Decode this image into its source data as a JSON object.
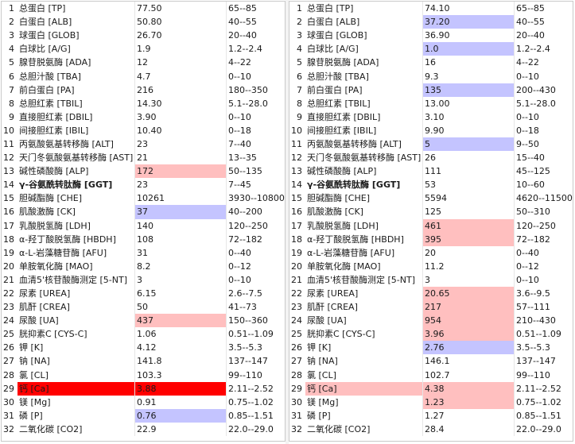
{
  "colors": {
    "high": "#ffbfbf",
    "critical": "#ff0000",
    "low": "#c4c4ff"
  },
  "panels": [
    {
      "rows": [
        {
          "no": "1",
          "name": "总蛋白 [TP]",
          "value": "77.50",
          "ref": "65--85",
          "flag": ""
        },
        {
          "no": "2",
          "name": "白蛋白 [ALB]",
          "value": "50.80",
          "ref": "40--55",
          "flag": ""
        },
        {
          "no": "3",
          "name": "球蛋白 [GLOB]",
          "value": "26.70",
          "ref": "20--40",
          "flag": ""
        },
        {
          "no": "4",
          "name": "白球比 [A/G]",
          "value": "1.9",
          "ref": "1.2--2.4",
          "flag": ""
        },
        {
          "no": "5",
          "name": "腺苷脱氨酶 [ADA]",
          "value": "12",
          "ref": "4--22",
          "flag": ""
        },
        {
          "no": "6",
          "name": "总胆汁酸 [TBA]",
          "value": "4.7",
          "ref": "0--10",
          "flag": ""
        },
        {
          "no": "7",
          "name": "前白蛋白 [PA]",
          "value": "216",
          "ref": "180--350",
          "flag": ""
        },
        {
          "no": "8",
          "name": "总胆红素 [TBIL]",
          "value": "14.30",
          "ref": "5.1--28.0",
          "flag": ""
        },
        {
          "no": "9",
          "name": "直接胆红素 [DBIL]",
          "value": "3.90",
          "ref": "0--10",
          "flag": ""
        },
        {
          "no": "10",
          "name": "间接胆红素 [IBIL]",
          "value": "10.40",
          "ref": "0--18",
          "flag": ""
        },
        {
          "no": "11",
          "name": "丙氨酸氨基转移酶 [ALT]",
          "value": "23",
          "ref": "7--40",
          "flag": ""
        },
        {
          "no": "12",
          "name": "天门冬氨酸氨基转移酶 [AST]",
          "value": "21",
          "ref": "13--35",
          "flag": ""
        },
        {
          "no": "13",
          "name": "碱性磷酸酶 [ALP]",
          "value": "172",
          "ref": "50--135",
          "flag": "high"
        },
        {
          "no": "14",
          "name": "γ-谷氨酰转肽酶 [GGT]",
          "value": "23",
          "ref": "7--45",
          "flag": "",
          "bold": true
        },
        {
          "no": "15",
          "name": "胆碱酯酶 [CHE]",
          "value": "10261",
          "ref": "3930--10800",
          "flag": ""
        },
        {
          "no": "16",
          "name": "肌酸激酶 [CK]",
          "value": "37",
          "ref": "40--200",
          "flag": "low"
        },
        {
          "no": "17",
          "name": "乳酸脱氢酶 [LDH]",
          "value": "140",
          "ref": "120--250",
          "flag": ""
        },
        {
          "no": "18",
          "name": "α-羟丁酸脱氢酶 [HBDH]",
          "value": "108",
          "ref": "72--182",
          "flag": ""
        },
        {
          "no": "19",
          "name": "α-L-岩藻糖苷酶 [AFU]",
          "value": "31",
          "ref": "0--40",
          "flag": ""
        },
        {
          "no": "20",
          "name": "单胺氧化酶 [MAO]",
          "value": "8.2",
          "ref": "0--12",
          "flag": ""
        },
        {
          "no": "21",
          "name": "血清5'核苷酸酶测定 [5-NT]",
          "value": "3",
          "ref": "0--10",
          "flag": ""
        },
        {
          "no": "22",
          "name": "尿素 [UREA]",
          "value": "6.15",
          "ref": "2.6--7.5",
          "flag": ""
        },
        {
          "no": "23",
          "name": "肌酐 [CREA]",
          "value": "50",
          "ref": "41--73",
          "flag": ""
        },
        {
          "no": "24",
          "name": "尿酸 [UA]",
          "value": "437",
          "ref": "150--360",
          "flag": "high"
        },
        {
          "no": "25",
          "name": "胱抑素C [CYS-C]",
          "value": "1.06",
          "ref": "0.51--1.09",
          "flag": ""
        },
        {
          "no": "26",
          "name": "钾 [K]",
          "value": "4.12",
          "ref": "3.5--5.3",
          "flag": ""
        },
        {
          "no": "27",
          "name": "钠 [NA]",
          "value": "141.8",
          "ref": "137--147",
          "flag": ""
        },
        {
          "no": "28",
          "name": "氯 [CL]",
          "value": "103.3",
          "ref": "99--110",
          "flag": ""
        },
        {
          "no": "29",
          "name": "钙 [Ca]",
          "value": "3.88",
          "ref": "2.11--2.52",
          "flag": "critical"
        },
        {
          "no": "30",
          "name": "镁 [Mg]",
          "value": "0.91",
          "ref": "0.75--1.02",
          "flag": ""
        },
        {
          "no": "31",
          "name": "磷 [P]",
          "value": "0.76",
          "ref": "0.85--1.51",
          "flag": "low"
        },
        {
          "no": "32",
          "name": "二氧化碳 [CO2]",
          "value": "22.9",
          "ref": "22.0--29.0",
          "flag": ""
        }
      ]
    },
    {
      "rows": [
        {
          "no": "1",
          "name": "总蛋白 [TP]",
          "value": "74.10",
          "ref": "65--85",
          "flag": ""
        },
        {
          "no": "2",
          "name": "白蛋白 [ALB]",
          "value": "37.20",
          "ref": "40--55",
          "flag": "low"
        },
        {
          "no": "3",
          "name": "球蛋白 [GLOB]",
          "value": "36.90",
          "ref": "20--40",
          "flag": ""
        },
        {
          "no": "4",
          "name": "白球比 [A/G]",
          "value": "1.0",
          "ref": "1.2--2.4",
          "flag": "low"
        },
        {
          "no": "5",
          "name": "腺苷脱氨酶 [ADA]",
          "value": "16",
          "ref": "4--22",
          "flag": ""
        },
        {
          "no": "6",
          "name": "总胆汁酸 [TBA]",
          "value": "9.3",
          "ref": "0--10",
          "flag": ""
        },
        {
          "no": "7",
          "name": "前白蛋白 [PA]",
          "value": "135",
          "ref": "200--430",
          "flag": "low"
        },
        {
          "no": "8",
          "name": "总胆红素 [TBIL]",
          "value": "13.00",
          "ref": "5.1--28.0",
          "flag": ""
        },
        {
          "no": "9",
          "name": "直接胆红素 [DBIL]",
          "value": "3.10",
          "ref": "0--10",
          "flag": ""
        },
        {
          "no": "10",
          "name": "间接胆红素 [IBIL]",
          "value": "9.90",
          "ref": "0--18",
          "flag": ""
        },
        {
          "no": "11",
          "name": "丙氨酸氨基转移酶 [ALT]",
          "value": "5",
          "ref": "9--50",
          "flag": "low"
        },
        {
          "no": "12",
          "name": "天门冬氨酸氨基转移酶 [AST]",
          "value": "26",
          "ref": "15--40",
          "flag": ""
        },
        {
          "no": "13",
          "name": "碱性磷酸酶 [ALP]",
          "value": "111",
          "ref": "45--125",
          "flag": ""
        },
        {
          "no": "14",
          "name": "γ-谷氨酰转肽酶 [GGT]",
          "value": "53",
          "ref": "10--60",
          "flag": "",
          "bold": true
        },
        {
          "no": "15",
          "name": "胆碱酯酶 [CHE]",
          "value": "5594",
          "ref": "4620--11500",
          "flag": ""
        },
        {
          "no": "16",
          "name": "肌酸激酶 [CK]",
          "value": "125",
          "ref": "50--310",
          "flag": ""
        },
        {
          "no": "17",
          "name": "乳酸脱氢酶 [LDH]",
          "value": "461",
          "ref": "120--250",
          "flag": "high"
        },
        {
          "no": "18",
          "name": "α-羟丁酸脱氢酶 [HBDH]",
          "value": "395",
          "ref": "72--182",
          "flag": "high"
        },
        {
          "no": "19",
          "name": "α-L-岩藻糖苷酶 [AFU]",
          "value": "20",
          "ref": "0--40",
          "flag": ""
        },
        {
          "no": "20",
          "name": "单胺氧化酶 [MAO]",
          "value": "11.2",
          "ref": "0--12",
          "flag": ""
        },
        {
          "no": "21",
          "name": "血清5'核苷酸酶测定 [5-NT]",
          "value": "3",
          "ref": "0--10",
          "flag": ""
        },
        {
          "no": "22",
          "name": "尿素 [UREA]",
          "value": "20.65",
          "ref": "3.6--9.5",
          "flag": "high"
        },
        {
          "no": "23",
          "name": "肌酐 [CREA]",
          "value": "217",
          "ref": "57--111",
          "flag": "high"
        },
        {
          "no": "24",
          "name": "尿酸 [UA]",
          "value": "954",
          "ref": "210--430",
          "flag": "high"
        },
        {
          "no": "25",
          "name": "胱抑素C [CYS-C]",
          "value": "3.96",
          "ref": "0.51--1.09",
          "flag": "high"
        },
        {
          "no": "26",
          "name": "钾 [K]",
          "value": "2.76",
          "ref": "3.5--5.3",
          "flag": "low"
        },
        {
          "no": "27",
          "name": "钠 [NA]",
          "value": "146.1",
          "ref": "137--147",
          "flag": ""
        },
        {
          "no": "28",
          "name": "氯 [CL]",
          "value": "102.7",
          "ref": "99--110",
          "flag": ""
        },
        {
          "no": "29",
          "name": "钙 [Ca]",
          "value": "4.38",
          "ref": "2.11--2.52",
          "flag": "high",
          "name_flag": "high"
        },
        {
          "no": "30",
          "name": "镁 [Mg]",
          "value": "1.23",
          "ref": "0.75--1.02",
          "flag": "high"
        },
        {
          "no": "31",
          "name": "磷 [P]",
          "value": "1.27",
          "ref": "0.85--1.51",
          "flag": ""
        },
        {
          "no": "32",
          "name": "二氧化碳 [CO2]",
          "value": "28.4",
          "ref": "22.0--29.0",
          "flag": ""
        }
      ]
    }
  ]
}
